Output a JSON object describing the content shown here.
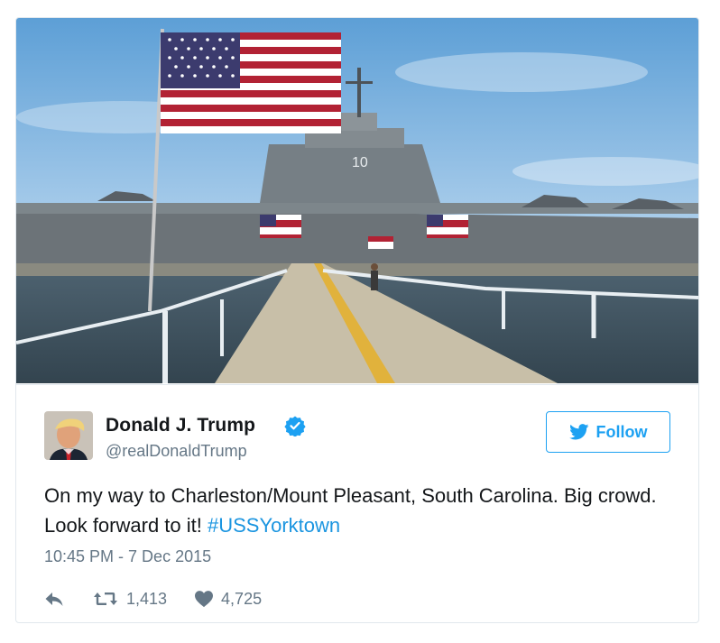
{
  "tweet": {
    "display_name": "Donald J. Trump",
    "handle": "@realDonaldTrump",
    "verified": true,
    "follow_label": "Follow",
    "text_main": "On my way to Charleston/Mount Pleasant, South Carolina. Big crowd. Look forward to it! ",
    "hashtag": "#USSYorktown",
    "timestamp": "10:45 PM - 7 Dec 2015",
    "retweets": "1,413",
    "likes": "4,725"
  },
  "photo": {
    "hull_number": "10"
  },
  "colors": {
    "brand_blue": "#1da1f2",
    "hashtag_blue": "#1b95e0",
    "muted_gray": "#657786",
    "text_dark": "#14171a",
    "border": "#e1e8ed"
  },
  "icons": [
    "verified-badge-icon",
    "twitter-bird-icon",
    "reply-icon",
    "retweet-icon",
    "heart-icon"
  ]
}
